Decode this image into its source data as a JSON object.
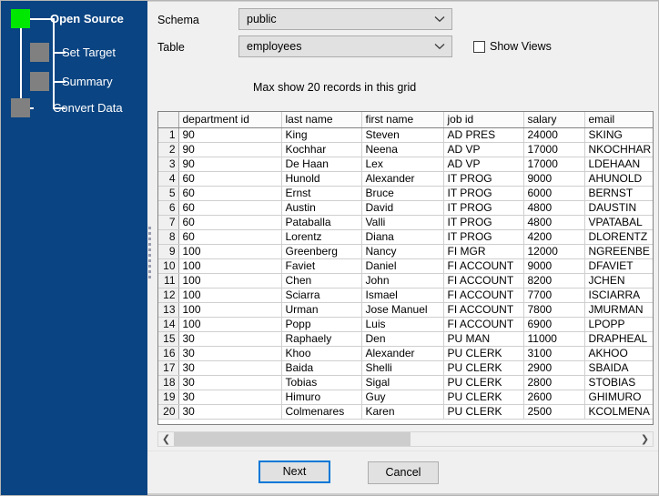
{
  "sidebar": {
    "steps": [
      {
        "label": "Open Source",
        "state": "active"
      },
      {
        "label": "Set Target",
        "state": "pending"
      },
      {
        "label": "Summary",
        "state": "pending"
      },
      {
        "label": "Convert Data",
        "state": "pending"
      }
    ],
    "background_color": "#0a4482",
    "active_color": "#00e800",
    "pending_color": "#808080"
  },
  "form": {
    "schema_label": "Schema",
    "schema_value": "public",
    "table_label": "Table",
    "table_value": "employees",
    "show_views_label": "Show Views",
    "show_views_checked": false,
    "max_records_note": "Max show 20 records in this grid"
  },
  "grid": {
    "columns": [
      "department id",
      "last name",
      "first name",
      "job id",
      "salary",
      "email"
    ],
    "rows": [
      {
        "n": "1",
        "department_id": "90",
        "last_name": "King",
        "first_name": "Steven",
        "job_id": "AD PRES",
        "salary": "24000",
        "email": "SKING"
      },
      {
        "n": "2",
        "department_id": "90",
        "last_name": "Kochhar",
        "first_name": "Neena",
        "job_id": "AD VP",
        "salary": "17000",
        "email": "NKOCHHAR"
      },
      {
        "n": "3",
        "department_id": "90",
        "last_name": "De Haan",
        "first_name": "Lex",
        "job_id": "AD VP",
        "salary": "17000",
        "email": "LDEHAAN"
      },
      {
        "n": "4",
        "department_id": "60",
        "last_name": "Hunold",
        "first_name": "Alexander",
        "job_id": "IT PROG",
        "salary": "9000",
        "email": "AHUNOLD"
      },
      {
        "n": "5",
        "department_id": "60",
        "last_name": "Ernst",
        "first_name": "Bruce",
        "job_id": "IT PROG",
        "salary": "6000",
        "email": "BERNST"
      },
      {
        "n": "6",
        "department_id": "60",
        "last_name": "Austin",
        "first_name": "David",
        "job_id": "IT PROG",
        "salary": "4800",
        "email": "DAUSTIN"
      },
      {
        "n": "7",
        "department_id": "60",
        "last_name": "Pataballa",
        "first_name": "Valli",
        "job_id": "IT PROG",
        "salary": "4800",
        "email": "VPATABAL"
      },
      {
        "n": "8",
        "department_id": "60",
        "last_name": "Lorentz",
        "first_name": "Diana",
        "job_id": "IT PROG",
        "salary": "4200",
        "email": "DLORENTZ"
      },
      {
        "n": "9",
        "department_id": "100",
        "last_name": "Greenberg",
        "first_name": "Nancy",
        "job_id": "FI MGR",
        "salary": "12000",
        "email": "NGREENBE"
      },
      {
        "n": "10",
        "department_id": "100",
        "last_name": "Faviet",
        "first_name": "Daniel",
        "job_id": "FI ACCOUNT",
        "salary": "9000",
        "email": "DFAVIET"
      },
      {
        "n": "11",
        "department_id": "100",
        "last_name": "Chen",
        "first_name": "John",
        "job_id": "FI ACCOUNT",
        "salary": "8200",
        "email": "JCHEN"
      },
      {
        "n": "12",
        "department_id": "100",
        "last_name": "Sciarra",
        "first_name": "Ismael",
        "job_id": "FI ACCOUNT",
        "salary": "7700",
        "email": "ISCIARRA"
      },
      {
        "n": "13",
        "department_id": "100",
        "last_name": "Urman",
        "first_name": "Jose Manuel",
        "job_id": "FI ACCOUNT",
        "salary": "7800",
        "email": "JMURMAN"
      },
      {
        "n": "14",
        "department_id": "100",
        "last_name": "Popp",
        "first_name": "Luis",
        "job_id": "FI ACCOUNT",
        "salary": "6900",
        "email": "LPOPP"
      },
      {
        "n": "15",
        "department_id": "30",
        "last_name": "Raphaely",
        "first_name": "Den",
        "job_id": "PU MAN",
        "salary": "11000",
        "email": "DRAPHEAL"
      },
      {
        "n": "16",
        "department_id": "30",
        "last_name": "Khoo",
        "first_name": "Alexander",
        "job_id": "PU CLERK",
        "salary": "3100",
        "email": "AKHOO"
      },
      {
        "n": "17",
        "department_id": "30",
        "last_name": "Baida",
        "first_name": "Shelli",
        "job_id": "PU CLERK",
        "salary": "2900",
        "email": "SBAIDA"
      },
      {
        "n": "18",
        "department_id": "30",
        "last_name": "Tobias",
        "first_name": "Sigal",
        "job_id": "PU CLERK",
        "salary": "2800",
        "email": "STOBIAS"
      },
      {
        "n": "19",
        "department_id": "30",
        "last_name": "Himuro",
        "first_name": "Guy",
        "job_id": "PU CLERK",
        "salary": "2600",
        "email": "GHIMURO"
      },
      {
        "n": "20",
        "department_id": "30",
        "last_name": "Colmenares",
        "first_name": "Karen",
        "job_id": "PU CLERK",
        "salary": "2500",
        "email": "KCOLMENA"
      }
    ]
  },
  "scrollbar": {
    "left_arrow": "❮",
    "right_arrow": "❯"
  },
  "buttons": {
    "next": "Next",
    "cancel": "Cancel",
    "focus_color": "#0078d7"
  }
}
